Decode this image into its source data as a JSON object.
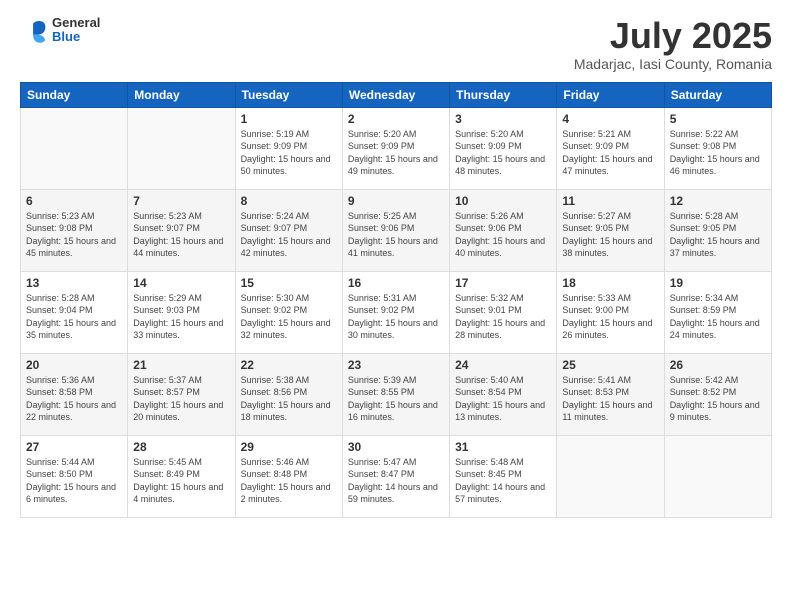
{
  "logo": {
    "general": "General",
    "blue": "Blue"
  },
  "title": "July 2025",
  "subtitle": "Madarjac, Iasi County, Romania",
  "days_of_week": [
    "Sunday",
    "Monday",
    "Tuesday",
    "Wednesday",
    "Thursday",
    "Friday",
    "Saturday"
  ],
  "weeks": [
    [
      {
        "day": "",
        "sunrise": "",
        "sunset": "",
        "daylight": ""
      },
      {
        "day": "",
        "sunrise": "",
        "sunset": "",
        "daylight": ""
      },
      {
        "day": "1",
        "sunrise": "Sunrise: 5:19 AM",
        "sunset": "Sunset: 9:09 PM",
        "daylight": "Daylight: 15 hours and 50 minutes."
      },
      {
        "day": "2",
        "sunrise": "Sunrise: 5:20 AM",
        "sunset": "Sunset: 9:09 PM",
        "daylight": "Daylight: 15 hours and 49 minutes."
      },
      {
        "day": "3",
        "sunrise": "Sunrise: 5:20 AM",
        "sunset": "Sunset: 9:09 PM",
        "daylight": "Daylight: 15 hours and 48 minutes."
      },
      {
        "day": "4",
        "sunrise": "Sunrise: 5:21 AM",
        "sunset": "Sunset: 9:09 PM",
        "daylight": "Daylight: 15 hours and 47 minutes."
      },
      {
        "day": "5",
        "sunrise": "Sunrise: 5:22 AM",
        "sunset": "Sunset: 9:08 PM",
        "daylight": "Daylight: 15 hours and 46 minutes."
      }
    ],
    [
      {
        "day": "6",
        "sunrise": "Sunrise: 5:23 AM",
        "sunset": "Sunset: 9:08 PM",
        "daylight": "Daylight: 15 hours and 45 minutes."
      },
      {
        "day": "7",
        "sunrise": "Sunrise: 5:23 AM",
        "sunset": "Sunset: 9:07 PM",
        "daylight": "Daylight: 15 hours and 44 minutes."
      },
      {
        "day": "8",
        "sunrise": "Sunrise: 5:24 AM",
        "sunset": "Sunset: 9:07 PM",
        "daylight": "Daylight: 15 hours and 42 minutes."
      },
      {
        "day": "9",
        "sunrise": "Sunrise: 5:25 AM",
        "sunset": "Sunset: 9:06 PM",
        "daylight": "Daylight: 15 hours and 41 minutes."
      },
      {
        "day": "10",
        "sunrise": "Sunrise: 5:26 AM",
        "sunset": "Sunset: 9:06 PM",
        "daylight": "Daylight: 15 hours and 40 minutes."
      },
      {
        "day": "11",
        "sunrise": "Sunrise: 5:27 AM",
        "sunset": "Sunset: 9:05 PM",
        "daylight": "Daylight: 15 hours and 38 minutes."
      },
      {
        "day": "12",
        "sunrise": "Sunrise: 5:28 AM",
        "sunset": "Sunset: 9:05 PM",
        "daylight": "Daylight: 15 hours and 37 minutes."
      }
    ],
    [
      {
        "day": "13",
        "sunrise": "Sunrise: 5:28 AM",
        "sunset": "Sunset: 9:04 PM",
        "daylight": "Daylight: 15 hours and 35 minutes."
      },
      {
        "day": "14",
        "sunrise": "Sunrise: 5:29 AM",
        "sunset": "Sunset: 9:03 PM",
        "daylight": "Daylight: 15 hours and 33 minutes."
      },
      {
        "day": "15",
        "sunrise": "Sunrise: 5:30 AM",
        "sunset": "Sunset: 9:02 PM",
        "daylight": "Daylight: 15 hours and 32 minutes."
      },
      {
        "day": "16",
        "sunrise": "Sunrise: 5:31 AM",
        "sunset": "Sunset: 9:02 PM",
        "daylight": "Daylight: 15 hours and 30 minutes."
      },
      {
        "day": "17",
        "sunrise": "Sunrise: 5:32 AM",
        "sunset": "Sunset: 9:01 PM",
        "daylight": "Daylight: 15 hours and 28 minutes."
      },
      {
        "day": "18",
        "sunrise": "Sunrise: 5:33 AM",
        "sunset": "Sunset: 9:00 PM",
        "daylight": "Daylight: 15 hours and 26 minutes."
      },
      {
        "day": "19",
        "sunrise": "Sunrise: 5:34 AM",
        "sunset": "Sunset: 8:59 PM",
        "daylight": "Daylight: 15 hours and 24 minutes."
      }
    ],
    [
      {
        "day": "20",
        "sunrise": "Sunrise: 5:36 AM",
        "sunset": "Sunset: 8:58 PM",
        "daylight": "Daylight: 15 hours and 22 minutes."
      },
      {
        "day": "21",
        "sunrise": "Sunrise: 5:37 AM",
        "sunset": "Sunset: 8:57 PM",
        "daylight": "Daylight: 15 hours and 20 minutes."
      },
      {
        "day": "22",
        "sunrise": "Sunrise: 5:38 AM",
        "sunset": "Sunset: 8:56 PM",
        "daylight": "Daylight: 15 hours and 18 minutes."
      },
      {
        "day": "23",
        "sunrise": "Sunrise: 5:39 AM",
        "sunset": "Sunset: 8:55 PM",
        "daylight": "Daylight: 15 hours and 16 minutes."
      },
      {
        "day": "24",
        "sunrise": "Sunrise: 5:40 AM",
        "sunset": "Sunset: 8:54 PM",
        "daylight": "Daylight: 15 hours and 13 minutes."
      },
      {
        "day": "25",
        "sunrise": "Sunrise: 5:41 AM",
        "sunset": "Sunset: 8:53 PM",
        "daylight": "Daylight: 15 hours and 11 minutes."
      },
      {
        "day": "26",
        "sunrise": "Sunrise: 5:42 AM",
        "sunset": "Sunset: 8:52 PM",
        "daylight": "Daylight: 15 hours and 9 minutes."
      }
    ],
    [
      {
        "day": "27",
        "sunrise": "Sunrise: 5:44 AM",
        "sunset": "Sunset: 8:50 PM",
        "daylight": "Daylight: 15 hours and 6 minutes."
      },
      {
        "day": "28",
        "sunrise": "Sunrise: 5:45 AM",
        "sunset": "Sunset: 8:49 PM",
        "daylight": "Daylight: 15 hours and 4 minutes."
      },
      {
        "day": "29",
        "sunrise": "Sunrise: 5:46 AM",
        "sunset": "Sunset: 8:48 PM",
        "daylight": "Daylight: 15 hours and 2 minutes."
      },
      {
        "day": "30",
        "sunrise": "Sunrise: 5:47 AM",
        "sunset": "Sunset: 8:47 PM",
        "daylight": "Daylight: 14 hours and 59 minutes."
      },
      {
        "day": "31",
        "sunrise": "Sunrise: 5:48 AM",
        "sunset": "Sunset: 8:45 PM",
        "daylight": "Daylight: 14 hours and 57 minutes."
      },
      {
        "day": "",
        "sunrise": "",
        "sunset": "",
        "daylight": ""
      },
      {
        "day": "",
        "sunrise": "",
        "sunset": "",
        "daylight": ""
      }
    ]
  ]
}
